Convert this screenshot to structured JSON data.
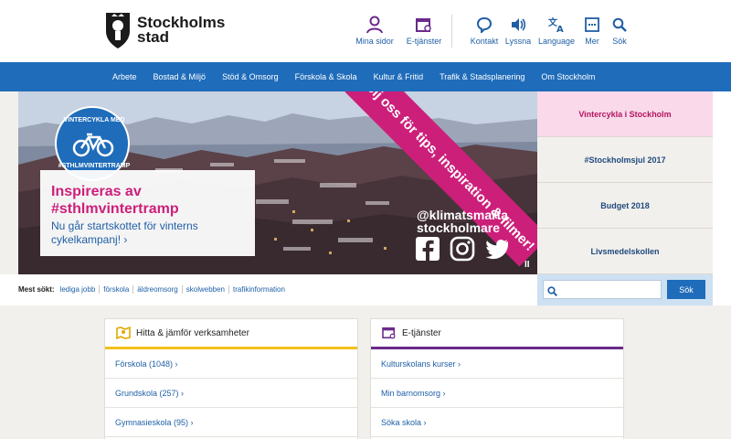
{
  "header": {
    "logo_text": "Stockholms stad",
    "tools": [
      {
        "label": "Mina sidor",
        "icon": "person-icon"
      },
      {
        "label": "E-tjänster",
        "icon": "eservices-icon"
      },
      {
        "label": "Kontakt",
        "icon": "speech-bubble-icon"
      },
      {
        "label": "Lyssna",
        "icon": "speaker-icon"
      },
      {
        "label": "Language",
        "icon": "translate-icon"
      },
      {
        "label": "Mer",
        "icon": "menu-icon"
      },
      {
        "label": "Sök",
        "icon": "search-icon"
      }
    ]
  },
  "nav": {
    "items": [
      "Arbete",
      "Bostad & Miljö",
      "Stöd & Omsorg",
      "Förskola & Skola",
      "Kultur & Fritid",
      "Trafik & Stadsplanering",
      "Om Stockholm"
    ]
  },
  "hero": {
    "badge_top": "VINTERCYKLA MED",
    "badge_bottom": "#STHLMVINTERTRAMP",
    "title": "Inspireras av #sthlmvintertramp",
    "subtitle": "Nu går startskottet för vinterns cykelkampanj! ›",
    "ribbon": "Följ oss för tips, inspiration & filmer!",
    "social_handle": "@klimatsmarta stockholmare",
    "pause": "II"
  },
  "side_tabs": [
    {
      "label": "Vintercykla i Stockholm",
      "active": true
    },
    {
      "label": "#Stockholmsjul 2017",
      "active": false
    },
    {
      "label": "Budget 2018",
      "active": false
    },
    {
      "label": "Livsmedelskollen",
      "active": false
    }
  ],
  "search": {
    "placeholder": "",
    "button_label": "Sök"
  },
  "most_searched": {
    "label": "Mest sökt:",
    "links": [
      "lediga jobb",
      "förskola",
      "äldreomsorg",
      "skolwebben",
      "trafikinformation"
    ]
  },
  "panels": {
    "left": {
      "title": "Hitta & jämför verksamheter",
      "items": [
        "Förskola (1048) ›",
        "Grundskola (257) ›",
        "Gymnasieskola (95) ›"
      ]
    },
    "right": {
      "title": "E-tjänster",
      "items": [
        "Kulturskolans kurser ›",
        "Min barnomsorg ›",
        "Söka skola ›"
      ]
    }
  },
  "colors": {
    "brand_blue": "#1f6cba",
    "magenta": "#cc1f7a",
    "yellow_accent": "#f2c01c",
    "purple_accent": "#6b2a8c"
  }
}
